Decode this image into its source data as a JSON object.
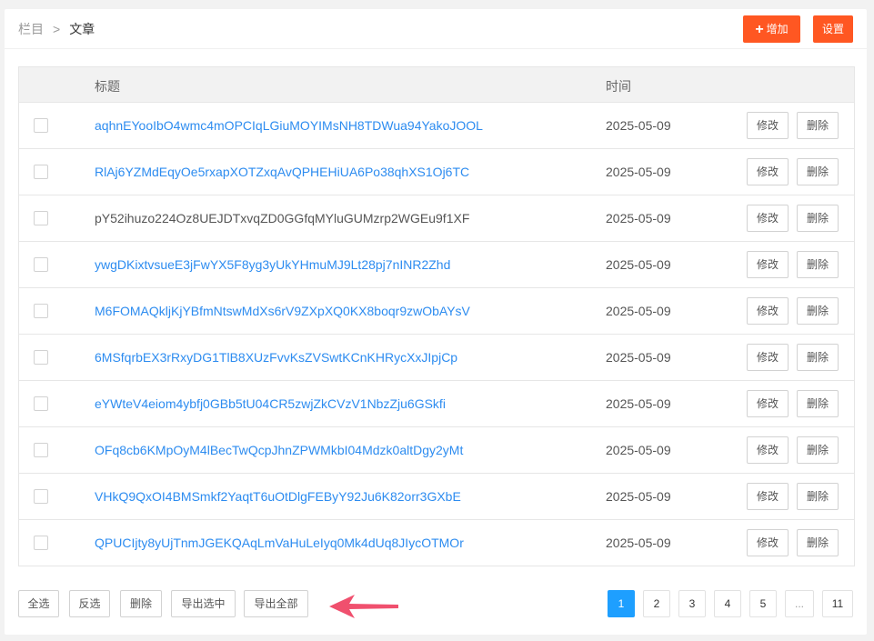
{
  "breadcrumb": {
    "parent": "栏目",
    "separator": ">",
    "current": "文章"
  },
  "header_buttons": {
    "add_label": "增加",
    "settings_label": "设置"
  },
  "table": {
    "columns": [
      "标题",
      "时间"
    ],
    "rows": [
      {
        "title": "aqhnEYooIbO4wmc4mOPCIqLGiuMOYIMsNH8TDWua94YakoJOOL",
        "date": "2025-05-09"
      },
      {
        "title": "RlAj6YZMdEqyOe5rxapXOTZxqAvQPHEHiUA6Po38qhXS1Oj6TC",
        "date": "2025-05-09"
      },
      {
        "title": "pY52ihuzo224Oz8UEJDTxvqZD0GGfqMYluGUMzrp2WGEu9f1XF",
        "date": "2025-05-09"
      },
      {
        "title": "ywgDKixtvsueE3jFwYX5F8yg3yUkYHmuMJ9Lt28pj7nINR2Zhd",
        "date": "2025-05-09"
      },
      {
        "title": "M6FOMAQkljKjYBfmNtswMdXs6rV9ZXpXQ0KX8boqr9zwObAYsV",
        "date": "2025-05-09"
      },
      {
        "title": "6MSfqrbEX3rRxyDG1TlB8XUzFvvKsZVSwtKCnKHRycXxJIpjCp",
        "date": "2025-05-09"
      },
      {
        "title": "eYWteV4eiom4ybfj0GBb5tU04CR5zwjZkCVzV1NbzZju6GSkfi",
        "date": "2025-05-09"
      },
      {
        "title": "OFq8cb6KMpOyM4lBecTwQcpJhnZPWMkbI04Mdzk0altDgy2yMt",
        "date": "2025-05-09"
      },
      {
        "title": "VHkQ9QxOI4BMSmkf2YaqtT6uOtDlgFEByY92Ju6K82orr3GXbE",
        "date": "2025-05-09"
      },
      {
        "title": "QPUCIjty8yUjTnmJGEKQAqLmVaHuLeIyq0Mk4dUq8JIycOTMOr",
        "date": "2025-05-09"
      }
    ],
    "edit_label": "修改",
    "delete_label": "删除"
  },
  "footer": {
    "select_all": "全选",
    "invert": "反选",
    "delete": "删除",
    "export_selected": "导出选中",
    "export_all": "导出全部"
  },
  "pager": {
    "pages": [
      "1",
      "2",
      "3",
      "4",
      "5"
    ],
    "ellipsis": "...",
    "last": "11",
    "current": "1"
  },
  "colors": {
    "accent_orange": "#ff5722",
    "link_blue": "#2d8cf0",
    "pager_active": "#1e9fff",
    "arrow_red": "#f0506e"
  },
  "icons": {
    "add": "plus-icon",
    "annotation": "arrow-left-icon"
  }
}
